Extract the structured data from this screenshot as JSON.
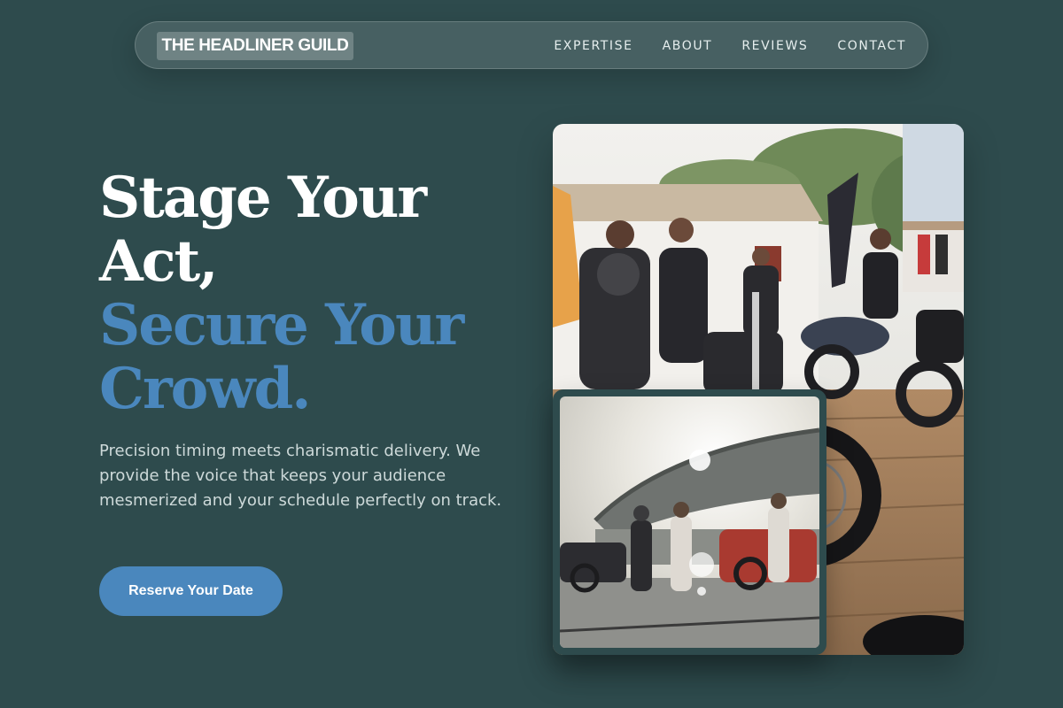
{
  "brand": {
    "name": "THE HEADLINER GUILD"
  },
  "nav": {
    "links": [
      "EXPERTISE",
      "ABOUT",
      "REVIEWS",
      "CONTACT"
    ]
  },
  "hero": {
    "headline_line1": "Stage Your Act,",
    "headline_line2": "Secure Your Crowd.",
    "description": "Precision timing meets charismatic delivery. We provide the voice that keeps your audience mesmerized and your schedule perfectly on track.",
    "cta_label": "Reserve Your Date"
  },
  "images": {
    "main": "motorcycle-rally-crowd-photo",
    "inset": "stadium-motorcycles-photo"
  },
  "colors": {
    "background": "#2e4b4d",
    "accent": "#4a87bd",
    "text": "#ffffff"
  }
}
